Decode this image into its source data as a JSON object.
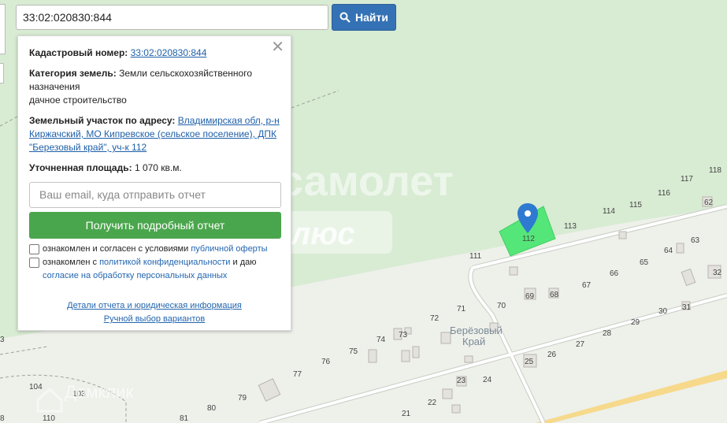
{
  "search": {
    "value": "33:02:020830:844",
    "button_label": "Найти"
  },
  "popup": {
    "cadastral_label": "Кадастровый номер:",
    "cadastral_value": "33:02:020830:844",
    "category_label": "Категория земель:",
    "category_value": "Земли сельскохозяйственного назначения",
    "category_use": "дачное строительство",
    "address_label": "Земельный участок по адресу:",
    "address_value": "Владимирская обл, р-н Киржачский, МО Кипревское (сельское поселение), ДПК \"Березовый край\", уч-к 112",
    "area_label": "Уточненная площадь:",
    "area_value": "1 070 кв.м.",
    "email_placeholder": "Ваш email, куда отправить отчет",
    "get_report_label": "Получить подробный отчет",
    "offer_text": "ознакомлен и согласен с условиями",
    "offer_link": "публичной оферты",
    "privacy_text_1": "ознакомлен с",
    "privacy_link": "политикой конфиденциальности",
    "privacy_text_2": "и даю",
    "consent_link": "согласие на обработку персональных данных",
    "details_link": "Детали отчета и юридическая информация",
    "manual_link": "Ручной выбор вариантов"
  },
  "map": {
    "watermark_1": "самолет",
    "watermark_2": "плюс",
    "watermark_3": "Домклик",
    "place_name_1": "Берёзовый",
    "place_name_2": "Край",
    "selected_plot": "112",
    "plots": [
      "111",
      "113",
      "114",
      "115",
      "116",
      "117",
      "118",
      "62",
      "63",
      "64",
      "65",
      "66",
      "67",
      "68",
      "69",
      "70",
      "71",
      "72",
      "73",
      "74",
      "75",
      "76",
      "77",
      "79",
      "80",
      "81",
      "21",
      "22",
      "23",
      "24",
      "25",
      "26",
      "27",
      "28",
      "29",
      "30",
      "31",
      "32",
      "103",
      "104",
      "110",
      "3",
      "8"
    ],
    "colors": {
      "forest": "#d7ead2",
      "field": "#eef0ea",
      "selected_plot": "#55e67a",
      "marker": "#2e7ad0",
      "road_main": "#f6d98b"
    }
  }
}
